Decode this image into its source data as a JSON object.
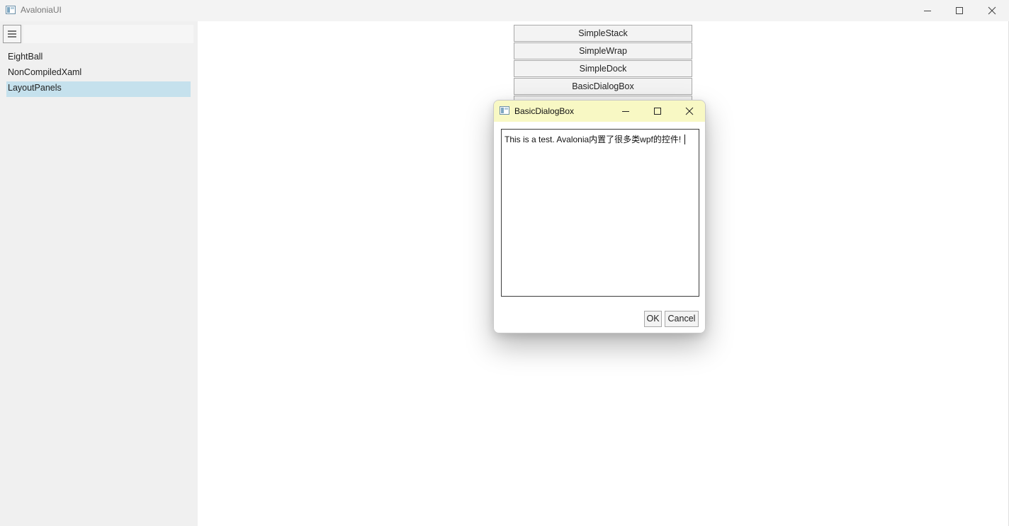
{
  "window": {
    "title": "AvaloniaUI",
    "icon": "app-window-icon"
  },
  "sidebar": {
    "menu_icon": "hamburger-icon",
    "search_value": "",
    "items": [
      {
        "label": "EightBall",
        "selected": false
      },
      {
        "label": "NonCompiledXaml",
        "selected": false
      },
      {
        "label": "LayoutPanels",
        "selected": true
      }
    ]
  },
  "main": {
    "buttons": [
      "SimpleStack",
      "SimpleWrap",
      "SimpleDock",
      "BasicDialogBox"
    ]
  },
  "dialog": {
    "title": "BasicDialogBox",
    "text": "This is a test. Avalonia内置了很多类wpf的控件!",
    "ok_label": "OK",
    "cancel_label": "Cancel"
  },
  "colors": {
    "selected_item_bg": "#c5e1ed",
    "dialog_titlebar_bg": "#f8f8c4",
    "sidebar_bg": "#f0f0f0",
    "titlebar_bg": "#f3f3f3"
  }
}
